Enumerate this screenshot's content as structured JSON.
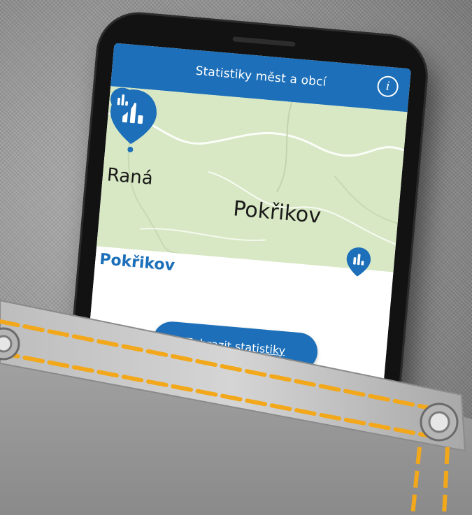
{
  "app": {
    "title": "Statistiky měst a obcí",
    "info_icon": "info-icon",
    "info_glyph": "i"
  },
  "map": {
    "cities": [
      {
        "name": "Raná"
      },
      {
        "name": "Pokřikov"
      }
    ],
    "pin_icon": "bar-chart-icon",
    "colors": {
      "land": "#d8e8c4",
      "roads": "#ffffff",
      "pin": "#1c6fb8"
    }
  },
  "panel": {
    "selected_city": "Pokřikov",
    "button_label": "Zobrazit statistiky"
  },
  "colors": {
    "accent": "#1c6fb8",
    "stitch": "#f2a81a"
  }
}
